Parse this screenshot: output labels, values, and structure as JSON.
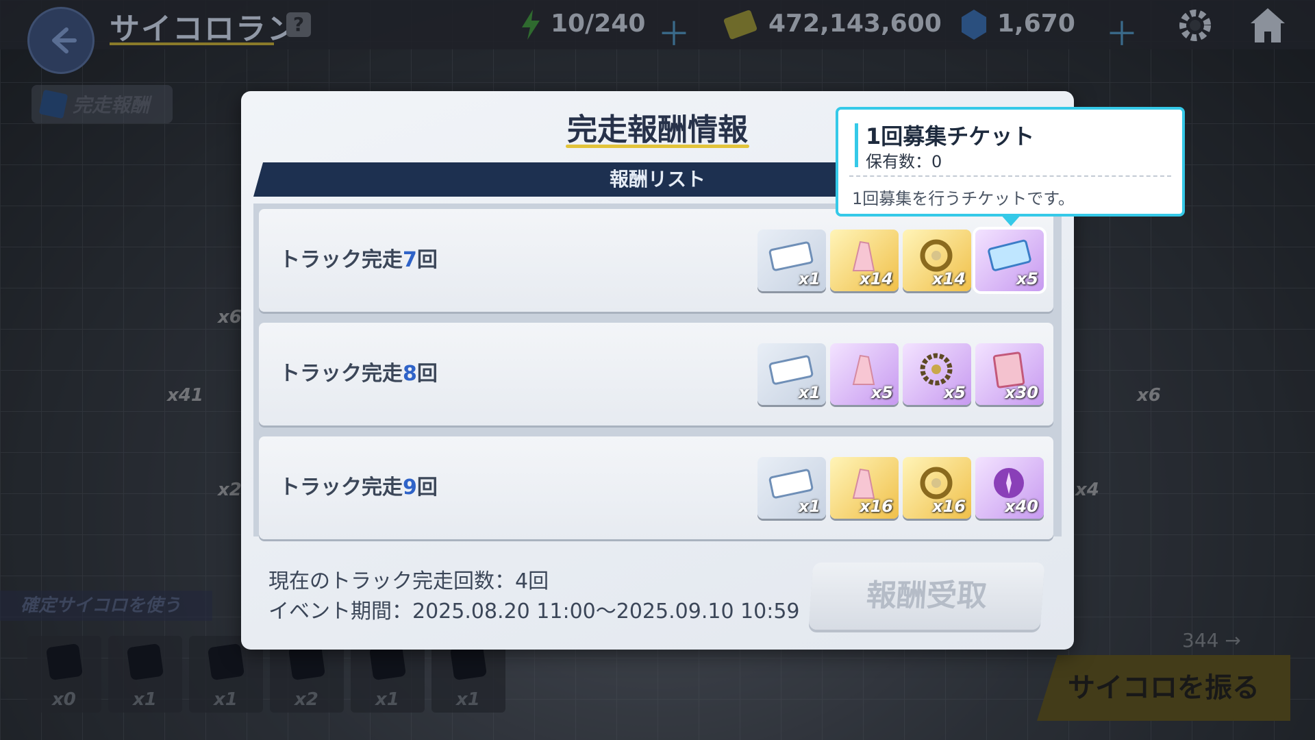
{
  "header": {
    "title": "サイコロラン",
    "help": "?",
    "stamina": "10/240",
    "coins": "472,143,600",
    "gems": "1,670",
    "plus": "＋"
  },
  "side_tag": {
    "label": "完走報酬"
  },
  "modal": {
    "title": "完走報酬情報",
    "list_header": "報酬リスト",
    "rows": [
      {
        "prefix": "トラック完走",
        "num": "7",
        "suffix": "回",
        "items": [
          {
            "q": "x1",
            "kind": "blue"
          },
          {
            "q": "x14",
            "kind": "gold"
          },
          {
            "q": "x14",
            "kind": "gold"
          },
          {
            "q": "x5",
            "kind": "purple"
          }
        ]
      },
      {
        "prefix": "トラック完走",
        "num": "8",
        "suffix": "回",
        "items": [
          {
            "q": "x1",
            "kind": "blue"
          },
          {
            "q": "x5",
            "kind": "purple"
          },
          {
            "q": "x5",
            "kind": "purple"
          },
          {
            "q": "x30",
            "kind": "purple"
          }
        ]
      },
      {
        "prefix": "トラック完走",
        "num": "9",
        "suffix": "回",
        "items": [
          {
            "q": "x1",
            "kind": "blue"
          },
          {
            "q": "x16",
            "kind": "gold"
          },
          {
            "q": "x16",
            "kind": "gold"
          },
          {
            "q": "x40",
            "kind": "purple"
          }
        ]
      }
    ],
    "current_count": "現在のトラック完走回数：4回",
    "event_period": "イベント期間：2025.08.20 11:00～2025.09.10 10:59",
    "claim_button": "報酬受取"
  },
  "tooltip": {
    "title": "1回募集チケット",
    "owned": "保有数：0",
    "description": "1回募集を行うチケットです。"
  },
  "background": {
    "dice_bar": "確定サイコロを使う",
    "slots": [
      "x0",
      "x1",
      "x1",
      "x2",
      "x1",
      "x1"
    ],
    "counter": "344",
    "roll_button": "サイコロを振る",
    "badges": [
      "x6",
      "x41",
      "x2",
      "x6",
      "x4"
    ]
  },
  "colors": {
    "accent": "#35c9e8",
    "header": "#1d3050",
    "number": "#2f63c8"
  }
}
